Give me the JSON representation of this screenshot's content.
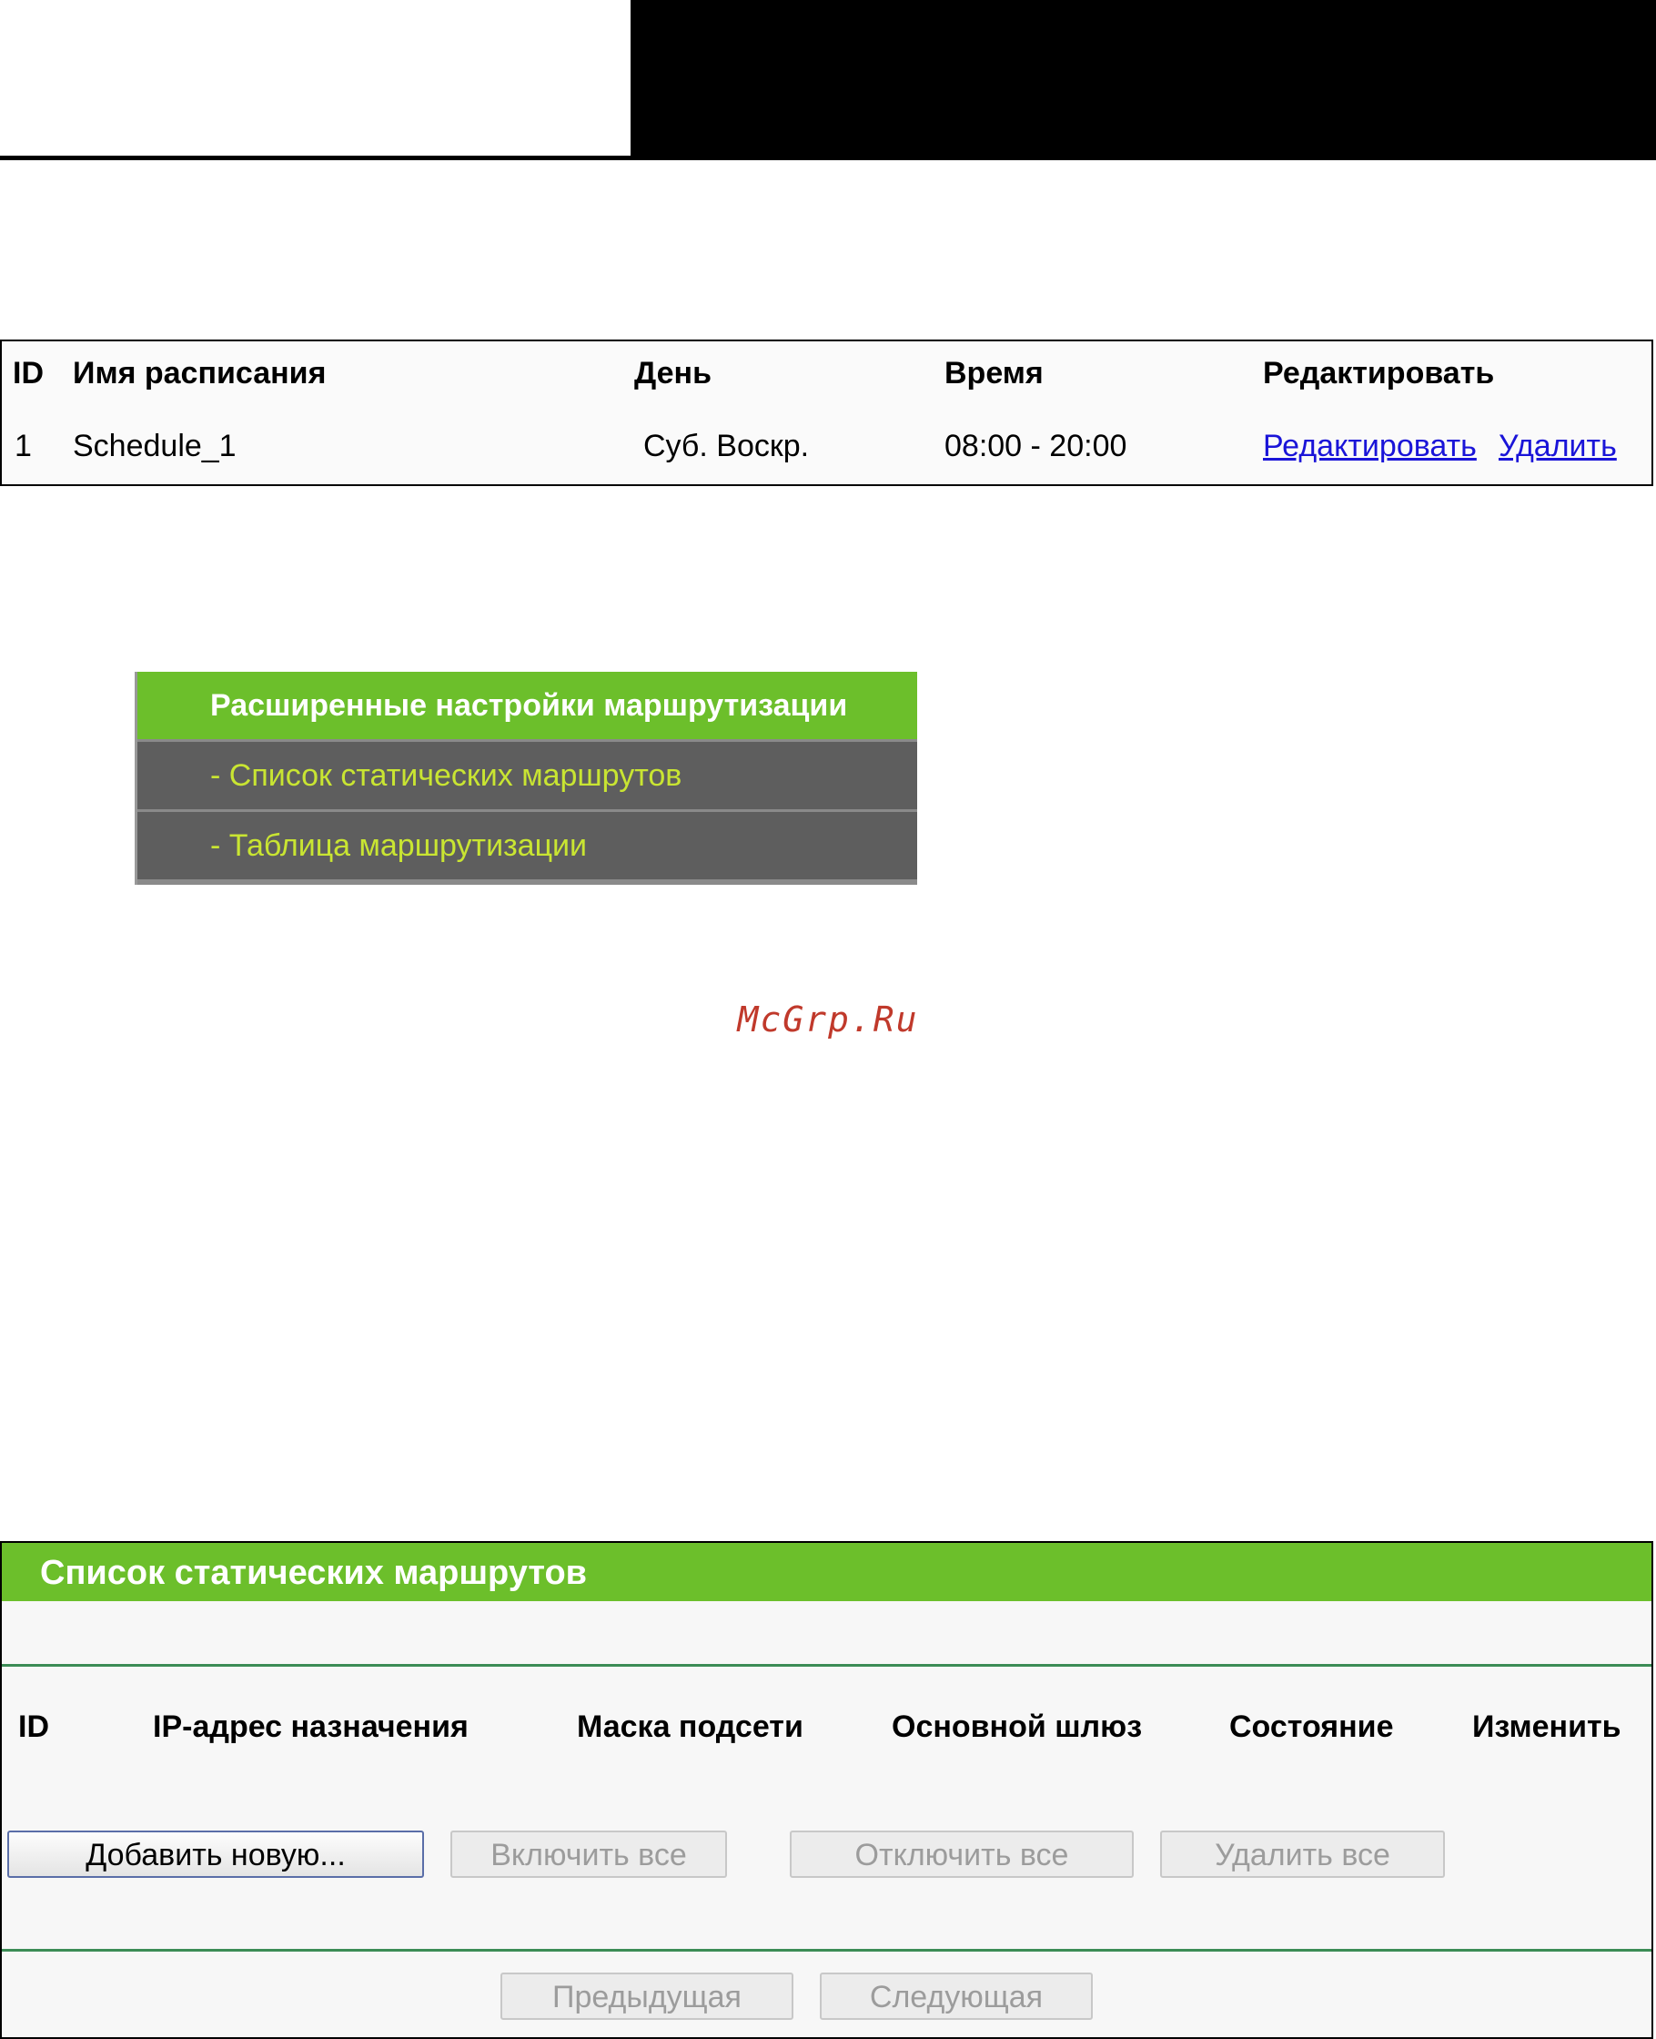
{
  "schedule_table": {
    "headers": [
      "ID",
      "Имя расписания",
      "День",
      "Время",
      "Редактировать"
    ],
    "row": {
      "id": "1",
      "name": "Schedule_1",
      "day": "Суб. Воскр.",
      "time": "08:00 - 20:00",
      "edit_link": "Редактировать",
      "delete_link": "Удалить"
    }
  },
  "route_menu": {
    "header": "Расширенные настройки маршрутизации",
    "items": [
      "- Список статических маршрутов",
      "- Таблица маршрутизации"
    ]
  },
  "watermark": "McGrp.Ru",
  "static_routes": {
    "title": "Список статических маршрутов",
    "columns": [
      "ID",
      "IP-адрес назначения",
      "Маска подсети",
      "Основной шлюз",
      "Состояние",
      "Изменить"
    ],
    "buttons": {
      "add_new": "Добавить новую...",
      "enable_all": "Включить все",
      "disable_all": "Отключить все",
      "delete_all": "Удалить все"
    },
    "pagination": {
      "prev": "Предыдущая",
      "next": "Следующая"
    }
  },
  "colors": {
    "menu_green": "#6cbf2b",
    "menu_gray": "#5e5e5e",
    "menu_item_text": "#c9e532",
    "link": "#1a14d8",
    "rule_green": "#3c8c56"
  }
}
